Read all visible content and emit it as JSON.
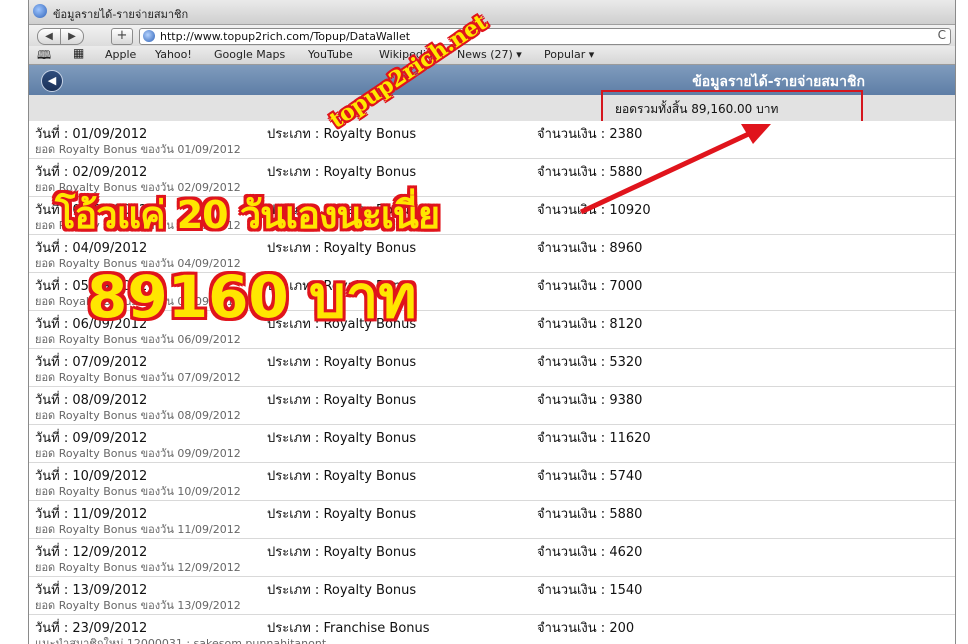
{
  "window": {
    "title": "ข้อมูลรายได้-รายจ่ายสมาชิก"
  },
  "toolbar": {
    "back_glyph": "◀",
    "forward_glyph": "▶",
    "add_glyph": "+",
    "url": "http://www.topup2rich.com/Topup/DataWallet",
    "reload_glyph": "C"
  },
  "bookmarks": {
    "items": [
      "Apple",
      "Yahoo!",
      "Google Maps",
      "YouTube",
      "Wikipedia",
      "News (27) ▾",
      "Popular ▾"
    ]
  },
  "page": {
    "title": "ข้อมูลรายได้-รายจ่ายสมาชิก",
    "back_glyph": "◀",
    "total": "ยอดรวมทั้งสิ้น 89,160.00 บาท"
  },
  "rows": [
    {
      "date": "วันที่ : 01/09/2012",
      "type": "ประเภท : Royalty Bonus",
      "amount": "จำนวนเงิน : 2380",
      "sub": "ยอด Royalty Bonus ของวัน 01/09/2012"
    },
    {
      "date": "วันที่ : 02/09/2012",
      "type": "ประเภท : Royalty Bonus",
      "amount": "จำนวนเงิน : 5880",
      "sub": "ยอด Royalty Bonus ของวัน 02/09/2012"
    },
    {
      "date": "วันที่ : 03/09/2012",
      "type": "ประเภท : Royalty Bonus",
      "amount": "จำนวนเงิน : 10920",
      "sub": "ยอด Royalty Bonus ของวัน 03/09/2012"
    },
    {
      "date": "วันที่ : 04/09/2012",
      "type": "ประเภท : Royalty Bonus",
      "amount": "จำนวนเงิน : 8960",
      "sub": "ยอด Royalty Bonus ของวัน 04/09/2012"
    },
    {
      "date": "วันที่ : 05/09/2012",
      "type": "ประเภท : Royalty Bonus",
      "amount": "จำนวนเงิน : 7000",
      "sub": "ยอด Royalty Bonus ของวัน 05/09/2012"
    },
    {
      "date": "วันที่ : 06/09/2012",
      "type": "ประเภท : Royalty Bonus",
      "amount": "จำนวนเงิน : 8120",
      "sub": "ยอด Royalty Bonus ของวัน 06/09/2012"
    },
    {
      "date": "วันที่ : 07/09/2012",
      "type": "ประเภท : Royalty Bonus",
      "amount": "จำนวนเงิน : 5320",
      "sub": "ยอด Royalty Bonus ของวัน 07/09/2012"
    },
    {
      "date": "วันที่ : 08/09/2012",
      "type": "ประเภท : Royalty Bonus",
      "amount": "จำนวนเงิน : 9380",
      "sub": "ยอด Royalty Bonus ของวัน 08/09/2012"
    },
    {
      "date": "วันที่ : 09/09/2012",
      "type": "ประเภท : Royalty Bonus",
      "amount": "จำนวนเงิน : 11620",
      "sub": "ยอด Royalty Bonus ของวัน 09/09/2012"
    },
    {
      "date": "วันที่ : 10/09/2012",
      "type": "ประเภท : Royalty Bonus",
      "amount": "จำนวนเงิน : 5740",
      "sub": "ยอด Royalty Bonus ของวัน 10/09/2012"
    },
    {
      "date": "วันที่ : 11/09/2012",
      "type": "ประเภท : Royalty Bonus",
      "amount": "จำนวนเงิน : 5880",
      "sub": "ยอด Royalty Bonus ของวัน 11/09/2012"
    },
    {
      "date": "วันที่ : 12/09/2012",
      "type": "ประเภท : Royalty Bonus",
      "amount": "จำนวนเงิน : 4620",
      "sub": "ยอด Royalty Bonus ของวัน 12/09/2012"
    },
    {
      "date": "วันที่ : 13/09/2012",
      "type": "ประเภท : Royalty Bonus",
      "amount": "จำนวนเงิน : 1540",
      "sub": "ยอด Royalty Bonus ของวัน 13/09/2012"
    },
    {
      "date": "วันที่ : 23/09/2012",
      "type": "ประเภท : Franchise Bonus",
      "amount": "จำนวนเงิน : 200",
      "sub": "แนะนำสมาชิกใหม่ 12000031 : sakesom punnahitanont"
    }
  ],
  "overlay": {
    "watermark": "topup2rich.net",
    "caption_line1": "โอ้วแค่ 20 วันเองนะเนี่ย",
    "caption_line2": "89160 บาท",
    "accent_red": "#e0141c",
    "accent_yellow": "#ffe600"
  }
}
